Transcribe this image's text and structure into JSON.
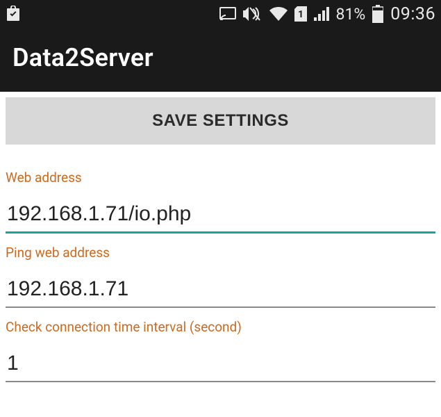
{
  "statusbar": {
    "battery_pct": "81%",
    "clock": "09:36"
  },
  "appbar": {
    "title": "Data2Server"
  },
  "buttons": {
    "save": "SAVE SETTINGS"
  },
  "form": {
    "web_address": {
      "label": "Web address",
      "value": "192.168.1.71/io.php"
    },
    "ping_address": {
      "label": "Ping web address",
      "value": "192.168.1.71"
    },
    "interval": {
      "label": "Check connection time interval (second)",
      "value": "1"
    }
  },
  "colors": {
    "accent": "#17a29a",
    "label": "#cc6a1f",
    "status_bg": "#1a1a1a"
  }
}
